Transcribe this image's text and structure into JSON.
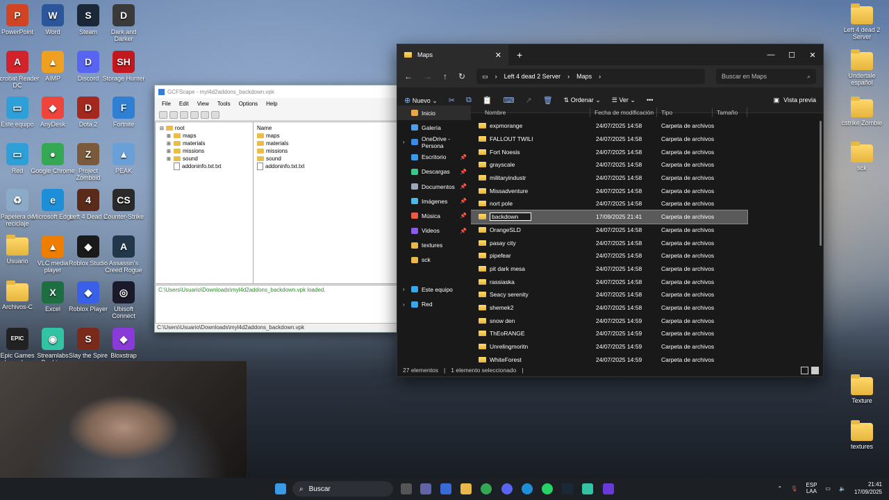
{
  "desktop": {
    "icons_left": [
      {
        "label": "PowerPoint",
        "glyph": "P",
        "color": "#d04423"
      },
      {
        "label": "Word",
        "glyph": "W",
        "color": "#2b579a"
      },
      {
        "label": "Steam",
        "glyph": "S",
        "color": "#1b2838"
      },
      {
        "label": "Dark and Darker",
        "glyph": "D",
        "color": "#3a3a3a"
      },
      {
        "label": "Acrobat Reader DC",
        "glyph": "A",
        "color": "#d2232a"
      },
      {
        "label": "AIMP",
        "glyph": "▲",
        "color": "#f0a020"
      },
      {
        "label": "Discord",
        "glyph": "D",
        "color": "#5865f2"
      },
      {
        "label": "Storage Hunter",
        "glyph": "SH",
        "color": "#c2171c"
      },
      {
        "label": "Este equipo",
        "glyph": "▭",
        "color": "#2f9fd8"
      },
      {
        "label": "AnyDesk",
        "glyph": "◆",
        "color": "#ef443b"
      },
      {
        "label": "Dota 2",
        "glyph": "D",
        "color": "#a3281e"
      },
      {
        "label": "Fortnite",
        "glyph": "F",
        "color": "#2f7fd3"
      },
      {
        "label": "Red",
        "glyph": "▭",
        "color": "#2f9fd8"
      },
      {
        "label": "Google Chrome",
        "glyph": "●",
        "color": "#34a853"
      },
      {
        "label": "Project Zomboid",
        "glyph": "Z",
        "color": "#7a5a3a"
      },
      {
        "label": "PEAK",
        "glyph": "▲",
        "color": "#6aa0d8"
      },
      {
        "label": "Papelera de reciclaje",
        "glyph": "♻",
        "color": "#8aaac8"
      },
      {
        "label": "Microsoft Edge",
        "glyph": "e",
        "color": "#1c8fd8"
      },
      {
        "label": "Left 4 Dead 2",
        "glyph": "4",
        "color": "#5a2a1a"
      },
      {
        "label": "Counter-Strike",
        "glyph": "CS",
        "color": "#2a2a2a"
      },
      {
        "label": "Usuario",
        "glyph": "",
        "color": "folder"
      },
      {
        "label": "VLC media player",
        "glyph": "▲",
        "color": "#ef7d00"
      },
      {
        "label": "Roblox Studio",
        "glyph": "◆",
        "color": "#1a1a1a"
      },
      {
        "label": "Assassin's Creed Rogue",
        "glyph": "A",
        "color": "#22384a"
      },
      {
        "label": "Archivos-C",
        "glyph": "",
        "color": "folder"
      },
      {
        "label": "Excel",
        "glyph": "X",
        "color": "#1d6f42"
      },
      {
        "label": "Roblox Player",
        "glyph": "◆",
        "color": "#3a60e8"
      },
      {
        "label": "Ubisoft Connect",
        "glyph": "◎",
        "color": "#1a1a2a"
      },
      {
        "label": "Epic Games Launcher",
        "glyph": "EPIC",
        "color": "#222"
      },
      {
        "label": "Streamlabs Desktop",
        "glyph": "◉",
        "color": "#31c3a2"
      },
      {
        "label": "Slay the Spire",
        "glyph": "S",
        "color": "#7a2a1a"
      },
      {
        "label": "Bloxstrap",
        "glyph": "◆",
        "color": "#8a3ad8"
      }
    ],
    "icons_right": [
      {
        "label": "Left 4 dead 2 Server"
      },
      {
        "label": "Undertale español"
      },
      {
        "label": "cstrike Zombie"
      },
      {
        "label": "sck"
      },
      {
        "label": "Texture"
      },
      {
        "label": "textures"
      }
    ]
  },
  "gcfscape": {
    "title": "GCFScape - myl4d2addons_backdown.vpk",
    "menu": [
      "File",
      "Edit",
      "View",
      "Tools",
      "Options",
      "Help"
    ],
    "tree_root": "root",
    "tree": [
      "maps",
      "materials",
      "missions",
      "sound",
      "addoninfo.txt.txt"
    ],
    "list_header": "Name",
    "list": [
      "maps",
      "materials",
      "missions",
      "sound",
      "addoninfo.txt.txt"
    ],
    "log": "C:\\Users\\Usuario\\Downloads\\myl4d2addons_backdown.vpk loaded.",
    "status": "C:\\Users\\Usuario\\Downloads\\myl4d2addons_backdown.vpk"
  },
  "explorer": {
    "tab_title": "Maps",
    "breadcrumb": [
      "Left 4 dead 2 Server",
      "Maps"
    ],
    "search_placeholder": "Buscar en Maps",
    "toolbar": {
      "new": "Nuevo",
      "sort": "Ordenar",
      "view": "Ver",
      "preview": "Vista previa"
    },
    "sidebar": [
      {
        "label": "Inicio",
        "color": "#e8a94a",
        "selected": true
      },
      {
        "label": "Galería",
        "color": "#4aa0e8"
      },
      {
        "label": "OneDrive - Persona",
        "color": "#3a8ae8",
        "chevron": true
      },
      {
        "label": "Escritorio",
        "color": "#3a9ae8",
        "pin": true
      },
      {
        "label": "Descargas",
        "color": "#3ac88a",
        "pin": true
      },
      {
        "label": "Documentos",
        "color": "#9aa8b8",
        "pin": true
      },
      {
        "label": "Imágenes",
        "color": "#4ab8e8",
        "pin": true
      },
      {
        "label": "Música",
        "color": "#e85a4a",
        "pin": true
      },
      {
        "label": "Videos",
        "color": "#8a5ae8",
        "pin": true
      },
      {
        "label": "textures",
        "color": "#e8b84a"
      },
      {
        "label": "sck",
        "color": "#e8b84a"
      },
      {
        "label": "",
        "color": "none"
      },
      {
        "label": "Este equipo",
        "color": "#3aa8e8",
        "chevron": true
      },
      {
        "label": "Red",
        "color": "#3aa8e8",
        "chevron": true
      }
    ],
    "columns": [
      "Nombre",
      "Fecha de modificación",
      "Tipo",
      "Tamaño"
    ],
    "files": [
      {
        "name": "expmorange",
        "date": "24/07/2025 14:58",
        "type": "Carpeta de archivos"
      },
      {
        "name": "FALLOUT TWILI",
        "date": "24/07/2025 14:58",
        "type": "Carpeta de archivos"
      },
      {
        "name": "Fort Noesis",
        "date": "24/07/2025 14:58",
        "type": "Carpeta de archivos"
      },
      {
        "name": "grayscale",
        "date": "24/07/2025 14:58",
        "type": "Carpeta de archivos"
      },
      {
        "name": "militaryindustr",
        "date": "24/07/2025 14:58",
        "type": "Carpeta de archivos"
      },
      {
        "name": "Missadventure",
        "date": "24/07/2025 14:58",
        "type": "Carpeta de archivos"
      },
      {
        "name": "nort pole",
        "date": "24/07/2025 14:58",
        "type": "Carpeta de archivos"
      },
      {
        "name": "backdown",
        "date": "17/09/2025 21:41",
        "type": "Carpeta de archivos",
        "selected": true
      },
      {
        "name": "OrangeSLD",
        "date": "24/07/2025 14:58",
        "type": "Carpeta de archivos"
      },
      {
        "name": "pasay city",
        "date": "24/07/2025 14:58",
        "type": "Carpeta de archivos"
      },
      {
        "name": "pipefear",
        "date": "24/07/2025 14:58",
        "type": "Carpeta de archivos"
      },
      {
        "name": "pit dark mesa",
        "date": "24/07/2025 14:58",
        "type": "Carpeta de archivos"
      },
      {
        "name": "rassiaska",
        "date": "24/07/2025 14:58",
        "type": "Carpeta de archivos"
      },
      {
        "name": "Seacy serenity",
        "date": "24/07/2025 14:58",
        "type": "Carpeta de archivos"
      },
      {
        "name": "shemek2",
        "date": "24/07/2025 14:58",
        "type": "Carpeta de archivos"
      },
      {
        "name": "snow den",
        "date": "24/07/2025 14:59",
        "type": "Carpeta de archivos"
      },
      {
        "name": "ThEoRANGE",
        "date": "24/07/2025 14:59",
        "type": "Carpeta de archivos"
      },
      {
        "name": "Unrelingmoritn",
        "date": "24/07/2025 14:59",
        "type": "Carpeta de archivos"
      },
      {
        "name": "WhiteForest",
        "date": "24/07/2025 14:59",
        "type": "Carpeta de archivos"
      }
    ],
    "status": {
      "count": "27 elementos",
      "selection": "1 elemento seleccionado"
    }
  },
  "taskbar": {
    "search": "Buscar",
    "lang": "ESP",
    "layout": "LAA",
    "time": "21:41",
    "date": "17/09/2025"
  }
}
